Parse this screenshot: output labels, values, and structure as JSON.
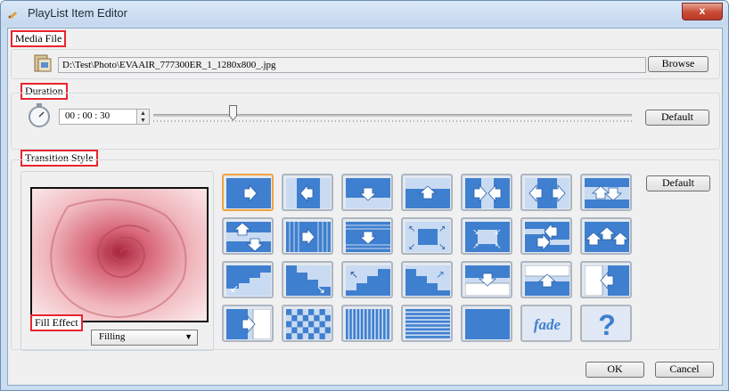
{
  "window": {
    "title": "PlayList Item Editor",
    "close_label": "x"
  },
  "media_file": {
    "label": "Media File",
    "path": "D:\\Test\\Photo\\EVAAIR_777300ER_1_1280x800_.jpg",
    "browse_label": "Browse"
  },
  "duration": {
    "label": "Duration",
    "value": "00 : 00 : 30",
    "slider_fraction": 0.16,
    "default_label": "Default"
  },
  "transition": {
    "label": "Transition Style",
    "default_label": "Default",
    "selected_index": 0,
    "styles": [
      "slide-right",
      "slide-left",
      "slide-down",
      "slide-up",
      "split-horizontal",
      "collapse-horizontal",
      "split-up-down",
      "split-vertical",
      "bars-right",
      "bars-down",
      "expand-corners",
      "collapse-corners",
      "split-left-right",
      "multi-up",
      "stairs-down-left",
      "stairs-down-right",
      "stairs-up-left",
      "stairs-up-right",
      "push-down",
      "push-up",
      "push-left",
      "push-right",
      "checkerboard",
      "vertical-blinds",
      "horizontal-blinds",
      "plain",
      "fade",
      "random"
    ],
    "fade_text": "fade",
    "random_text": "?"
  },
  "fill_effect": {
    "label": "Fill Effect",
    "selected": "Filling"
  },
  "footer": {
    "ok_label": "OK",
    "cancel_label": "Cancel"
  },
  "colors": {
    "accent_red": "#e8242e",
    "tile_blue": "#3f7fcf",
    "selected_orange": "#f0a442"
  }
}
